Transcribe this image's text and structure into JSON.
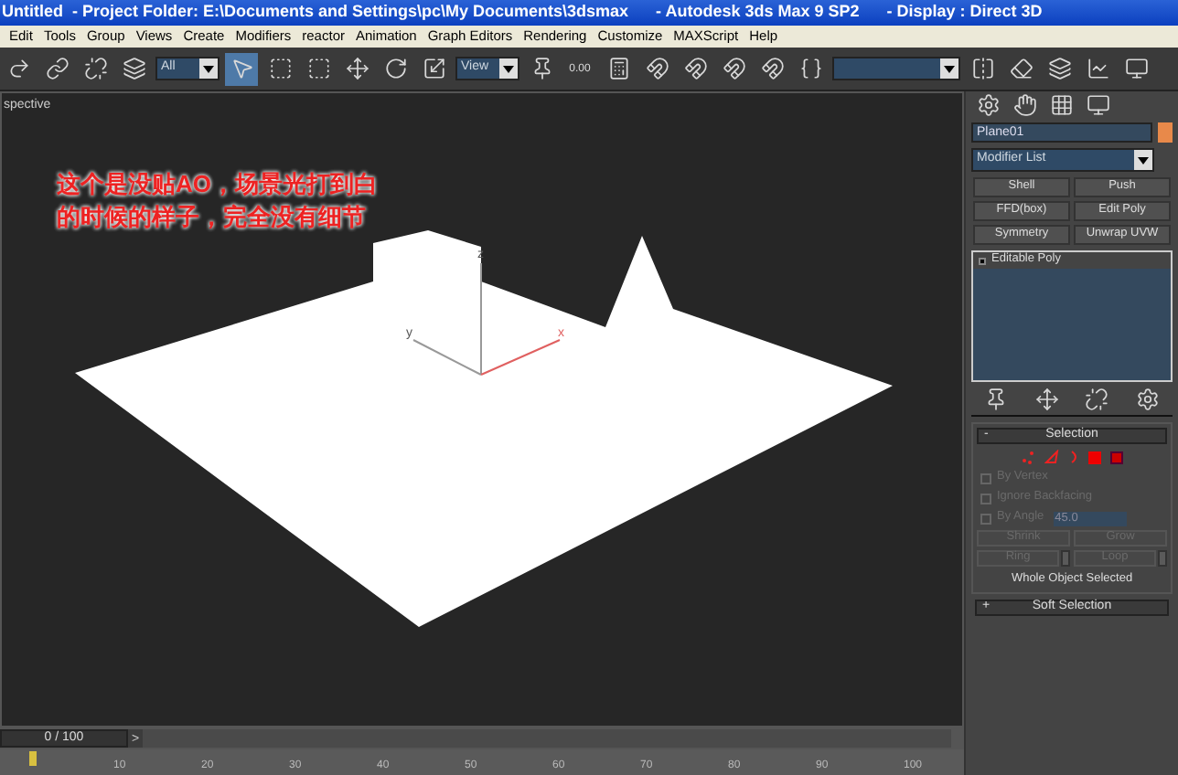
{
  "window": {
    "title": "Untitled  - Project Folder: E:\\Documents and Settings\\pc\\My Documents\\3dsmax      - Autodesk 3ds Max 9 SP2      - Display : Direct 3D"
  },
  "menu": [
    "Edit",
    "Tools",
    "Group",
    "Views",
    "Create",
    "Modifiers",
    "reactor",
    "Animation",
    "Graph Editors",
    "Rendering",
    "Customize",
    "MAXScript",
    "Help"
  ],
  "toolbar": {
    "selection_filter": "All",
    "coordinate_system": "View",
    "spinner_snap": "0.00"
  },
  "viewport": {
    "label": "spective",
    "annotation": [
      "这个是没贴AO，场景光打到白",
      "的时候的样子，完全没有细节"
    ],
    "axes": [
      "z",
      "y",
      "x"
    ]
  },
  "command_panel": {
    "object_name": "Plane01",
    "modifier_list": "Modifier List",
    "modifier_buttons": [
      "Shell",
      "Push",
      "FFD(box)",
      "Edit Poly",
      "Symmetry",
      "Unwrap UVW"
    ],
    "stack": [
      {
        "label": "Editable Poly"
      }
    ],
    "selection": {
      "sign": "-",
      "title": "Selection",
      "checkboxes": [
        {
          "label": "By Vertex",
          "checked": false,
          "disabled": true
        },
        {
          "label": "Ignore Backfacing",
          "checked": false,
          "disabled": true
        },
        {
          "label": "By Angle",
          "checked": false,
          "disabled": true
        }
      ],
      "angle": "45.0",
      "buttons": [
        {
          "label": "Shrink",
          "disabled": true,
          "spinner": false
        },
        {
          "label": "Grow",
          "disabled": true,
          "spinner": false
        },
        {
          "label": "Ring",
          "disabled": true,
          "spinner": true
        },
        {
          "label": "Loop",
          "disabled": true,
          "spinner": true
        }
      ],
      "status": "Whole Object Selected"
    },
    "soft_selection": {
      "sign": "+",
      "title": "Soft Selection"
    }
  },
  "time_slider": {
    "frame": "0 / 100",
    "next": ">",
    "level": 0
  },
  "track_bar": {
    "ticks": [
      "10",
      "20",
      "30",
      "40",
      "50",
      "60",
      "70",
      "80",
      "90",
      "100"
    ]
  }
}
